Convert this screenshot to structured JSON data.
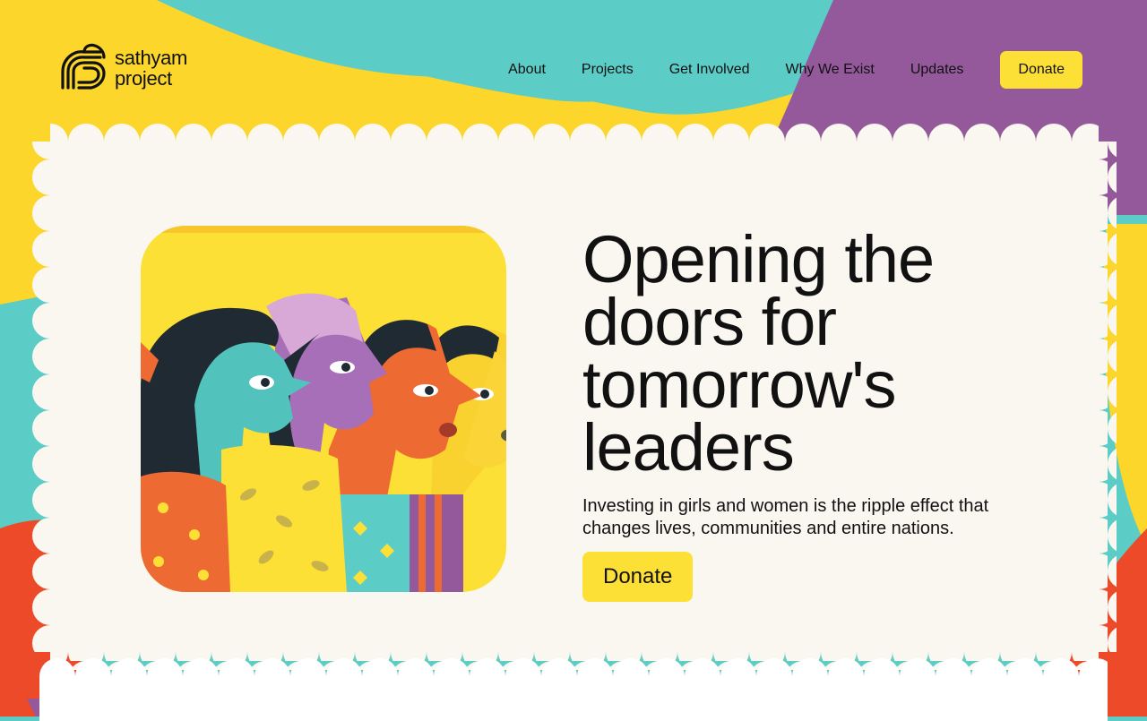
{
  "brand": {
    "line1": "sathyam",
    "line2": "project"
  },
  "nav": {
    "items": [
      "About",
      "Projects",
      "Get Involved",
      "Why We Exist",
      "Updates"
    ],
    "donate_label": "Donate"
  },
  "hero": {
    "headline": "Opening the doors for tomorrow's leaders",
    "subtext": "Investing in girls and women is the ripple effect that changes lives, communities and entire nations.",
    "cta_label": "Donate",
    "image_icon": "women-profiles-illustration"
  },
  "colors": {
    "teal": "#5cccc6",
    "yellow": "#fdd62b",
    "purple": "#93599a",
    "red": "#ec4a29",
    "card": "#faf7f0",
    "button": "#fde035"
  }
}
